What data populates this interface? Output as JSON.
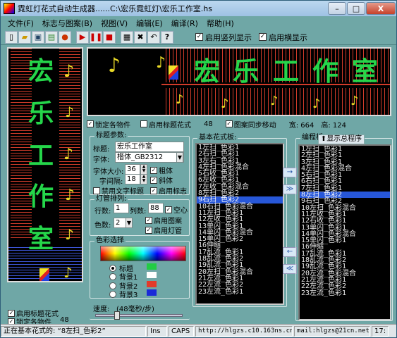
{
  "window": {
    "title": "霓虹灯花式自动生成器......C:\\宏乐霓虹灯\\宏乐工作室.hs",
    "minimize": "–",
    "maximize": "□",
    "close": "X"
  },
  "menu": {
    "items": [
      "文件(F)",
      "标志与图案(B)",
      "视图(V)",
      "编辑(E)",
      "编译(R)",
      "帮助(H)"
    ]
  },
  "toolbar": {
    "vertical_display_label": "启用竖列显示",
    "vertical_display_checked": true,
    "horizontal_display_label": "启用横显示",
    "horizontal_display_checked": true
  },
  "preview": {
    "vertical_chars": [
      "宏",
      "乐",
      "工",
      "作",
      "室"
    ],
    "horizontal_text": "宏乐工作室",
    "note_glyph": "♪",
    "clef_glyph": "𝄞"
  },
  "options_row": {
    "lock_items_label": "锁定各物件",
    "lock_items_checked": true,
    "title_pattern_label": "启用标题花式",
    "title_pattern_checked": false,
    "title_pattern_count": "48",
    "sync_move_label": "图案同步移动",
    "sync_move_checked": true,
    "width_label": "宽: 664",
    "height_label": "高: 124"
  },
  "title_params": {
    "group_label": "标题参数:",
    "title_label": "标题:",
    "title_value": "宏乐工作室",
    "font_label": "字体:",
    "font_value": "楷体_GB2312",
    "font_size_label": "字体大小:",
    "font_size_value": "36",
    "char_spacing_label": "字间隔:",
    "char_spacing_value": "18",
    "bold_label": "粗体",
    "bold_checked": true,
    "italic_label": "斜体",
    "italic_checked": true,
    "disable_text_label": "禁用文字标题",
    "disable_text_checked": false,
    "enable_logo_label": "启用标志",
    "enable_logo_checked": true
  },
  "lamp_layout": {
    "group_label": "灯管排列:",
    "rows_label": "行数:",
    "rows_value": "1",
    "cols_label": "列数:",
    "cols_value": "88",
    "hollow_label": "空心",
    "hollow_checked": true,
    "colors_label": "色数:",
    "colors_value": "2",
    "enable_pattern_label": "启用图案",
    "enable_pattern_checked": true,
    "enable_lamp_label": "启用灯管",
    "enable_lamp_checked": true
  },
  "color_select": {
    "group_label": "色彩选择",
    "options": [
      {
        "label": "标题",
        "selected": true,
        "color": "#22cc44"
      },
      {
        "label": "背景1",
        "selected": false,
        "color": "#ffffff"
      },
      {
        "label": "背景2",
        "selected": false,
        "color": "#e23a2a"
      },
      {
        "label": "背景3",
        "selected": false,
        "color": "#1a2ad8"
      }
    ]
  },
  "speed": {
    "label": "速度:",
    "value_text": "(48毫秒/步)",
    "level": 0.25
  },
  "basic_patterns": {
    "group_label": "基本花式板:",
    "items": [
      "1左扫_色彩1",
      "2右扫_色彩1",
      "3左右_色彩1",
      "4左扫_色彩混合",
      "5右收_色彩1",
      "6左收_色彩1",
      "7左收_色彩混合",
      "8左扫_色彩2",
      "9右扫_色彩2",
      "10右扫_色彩混合",
      "11左扫_色彩1",
      "12左收_色彩1",
      "13单闪_色彩1",
      "14单闪_色彩混合",
      "15单闪_色彩2",
      "16伸缩",
      "17乱流_色彩1",
      "18乱流_色彩2",
      "19乱流_色彩1",
      "20左扫_色彩混合",
      "21左流_色彩1",
      "22左流_色彩2",
      "23左流_色彩1"
    ],
    "selected_index": 8
  },
  "program_board": {
    "group_label": "编程板:",
    "show_program_button": "显示总程序",
    "items": [
      "1左扫_色彩1",
      "2左扫_色彩1",
      "3左扫_色彩1",
      "4左扫_色彩混合",
      "5右扫_色彩1",
      "6右扫_色彩1",
      "7左扫_色彩1",
      "8左扫_色彩2",
      "9右扫_色彩2",
      "10左扫_色彩混合",
      "11左收_色彩1",
      "12右收_色彩1",
      "13单闪_色彩1",
      "14单闪_色彩混合",
      "15单闪_色彩1",
      "16伸缩",
      "17乱流_色彩1",
      "18乱流_色彩2",
      "19乱流_色彩1",
      "20左流_色彩混合",
      "21左流_色彩1",
      "22左流_色彩2",
      "23左流_色彩1"
    ],
    "selected_index": 7
  },
  "transfer_buttons": [
    "→",
    "≫",
    "←",
    "≪"
  ],
  "left_bottom": {
    "title_pattern_label": "启用标题花式",
    "title_pattern_checked": true,
    "lock_items_label": "锁定各物件",
    "lock_items_checked": true,
    "lock_count": "48"
  },
  "status": {
    "message": "正在基本花式的: “8左扫_色彩2”",
    "ins": "Ins",
    "caps": "CAPS",
    "url": "http://hlgzs.c10.163ns.cn",
    "mail": "mail:hlgzs@21cn.net",
    "time": "17:"
  }
}
